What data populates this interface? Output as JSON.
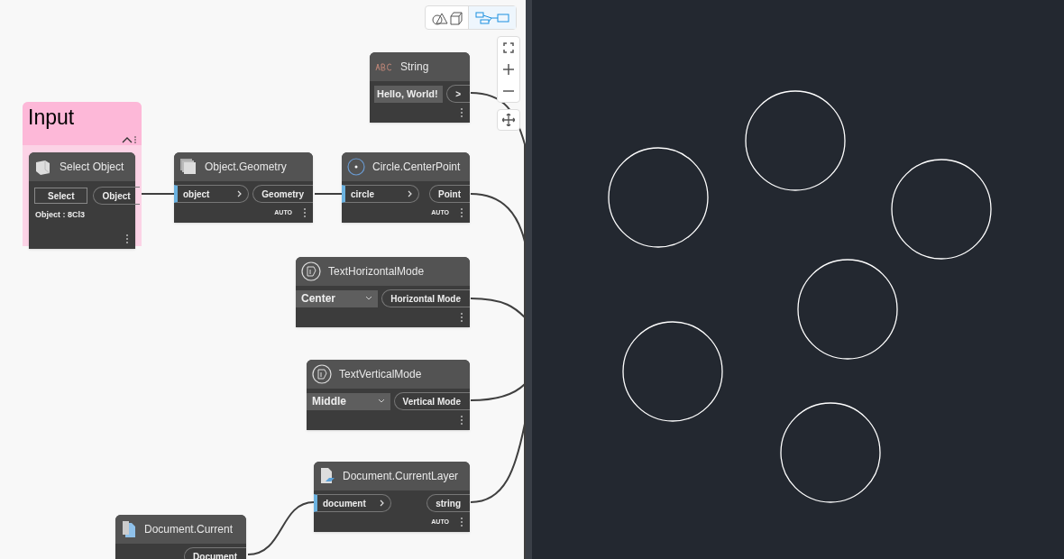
{
  "view_toggle": [
    {
      "selected": false
    },
    {
      "selected": true
    }
  ],
  "group": {
    "title": "Input"
  },
  "nodes": [
    {
      "kind": "string-input",
      "title": "String",
      "value": "Hello, World!",
      "outputs": [
        ">"
      ]
    },
    {
      "kind": "select",
      "title": "Select Object",
      "button": "Select",
      "outputs": [
        "Object"
      ],
      "info": "Object : 8Cl3"
    },
    {
      "kind": "function",
      "title": "Object.Geometry",
      "inputs": [
        "object"
      ],
      "outputs": [
        "Geometry"
      ],
      "lacing": "AUTO"
    },
    {
      "kind": "function",
      "title": "Circle.CenterPoint",
      "inputs": [
        "circle"
      ],
      "outputs": [
        "Point"
      ],
      "lacing": "AUTO"
    },
    {
      "kind": "dropdown",
      "title": "TextHorizontalMode",
      "value": "Center",
      "outputs": [
        "Horizontal Mode"
      ]
    },
    {
      "kind": "dropdown",
      "title": "TextVerticalMode",
      "value": "Middle",
      "outputs": [
        "Vertical Mode"
      ]
    },
    {
      "kind": "function",
      "title": "Document.CurrentLayer",
      "inputs": [
        "document"
      ],
      "outputs": [
        "string"
      ],
      "lacing": "AUTO"
    },
    {
      "kind": "function",
      "title": "Document.Current",
      "outputs": [
        "Document"
      ]
    }
  ]
}
